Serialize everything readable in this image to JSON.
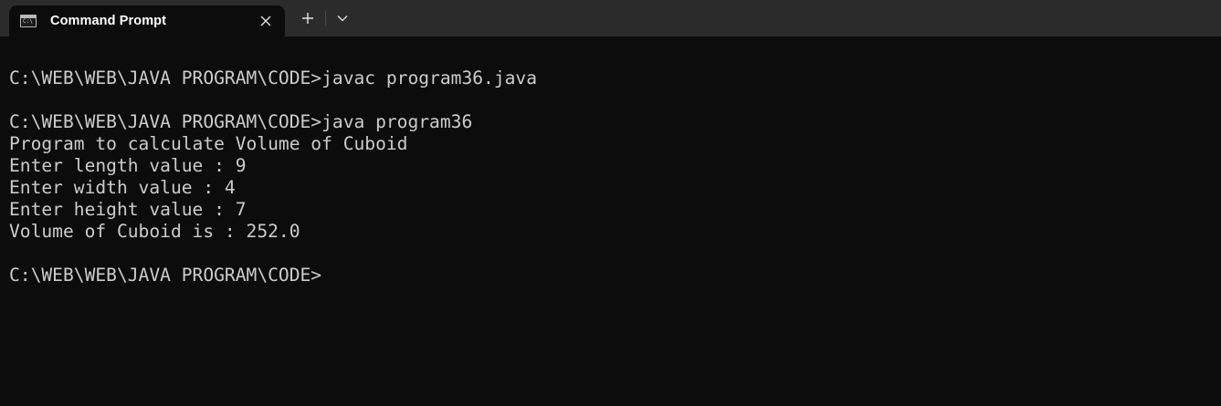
{
  "window": {
    "tab_title": "Command Prompt",
    "tab_icon": "console-icon",
    "close_icon": "close-icon",
    "new_tab_icon": "plus-icon",
    "dropdown_icon": "chevron-down-icon"
  },
  "colors": {
    "background": "#0c0c0c",
    "tabbar": "#2b2b2b",
    "text": "#cccccc",
    "tab_text": "#ffffff"
  },
  "terminal": {
    "lines": [
      "",
      "C:\\WEB\\WEB\\JAVA PROGRAM\\CODE>javac program36.java",
      "",
      "C:\\WEB\\WEB\\JAVA PROGRAM\\CODE>java program36",
      "Program to calculate Volume of Cuboid",
      "Enter length value : 9",
      "Enter width value : 4",
      "Enter height value : 7",
      "Volume of Cuboid is : 252.0",
      "",
      "C:\\WEB\\WEB\\JAVA PROGRAM\\CODE>"
    ]
  }
}
